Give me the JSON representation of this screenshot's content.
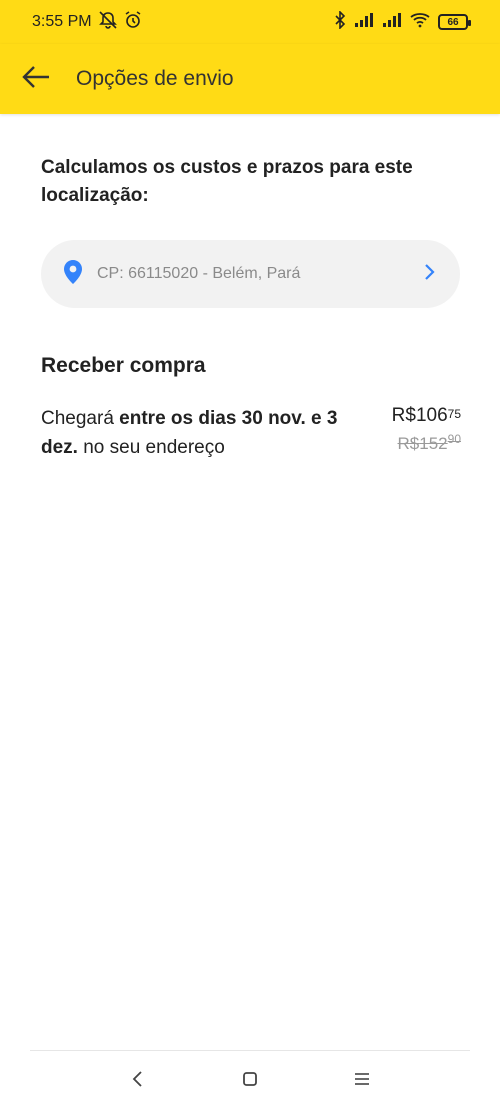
{
  "status_bar": {
    "time": "3:55 PM",
    "battery": "66",
    "icons": [
      "muted-notification-icon",
      "alarm-icon",
      "bluetooth-icon",
      "signal-icon",
      "signal-icon",
      "wifi-icon",
      "battery-icon"
    ]
  },
  "app_bar": {
    "back_icon": "arrow-left-icon",
    "title": "Opções de envio"
  },
  "intro": "Calculamos os custos e prazos para este localização:",
  "location": {
    "icon": "location-pin-icon",
    "text": "CP: 66115020 - Belém, Pará",
    "chevron_icon": "chevron-right-icon",
    "pin_color": "#3483FA"
  },
  "section_title": "Receber compra",
  "option": {
    "text_prefix": "Chegará ",
    "text_bold": "entre os dias 30 nov. e 3 dez.",
    "text_suffix": " no seu endereço",
    "price": {
      "currency": "R$",
      "integer": "106",
      "cents": "75"
    },
    "old_price": {
      "currency": "R$",
      "integer": "152",
      "cents": "90"
    }
  },
  "nav_bar": {
    "back_icon": "nav-back-icon",
    "home_icon": "nav-home-icon",
    "menu_icon": "nav-menu-icon"
  },
  "colors": {
    "header_yellow": "#FFDB15",
    "accent_blue": "#3483FA"
  }
}
